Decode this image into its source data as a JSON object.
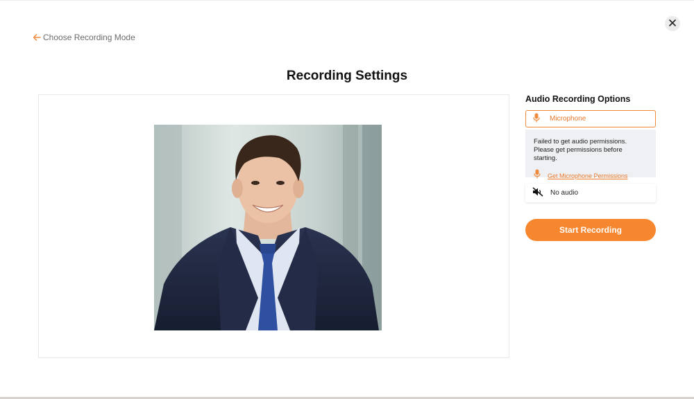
{
  "nav": {
    "back_label": "Choose Recording Mode",
    "back_icon": "arrow-left-icon",
    "close_icon": "close-icon"
  },
  "page": {
    "title": "Recording Settings"
  },
  "preview": {
    "description_icon": "camera-feed"
  },
  "audio": {
    "heading": "Audio Recording Options",
    "microphone_label": "Microphone",
    "permission_message": "Failed to get audio permissions. Please get permissions before starting.",
    "permission_link": "Get Microphone Permissions",
    "no_audio_label": "No audio",
    "start_label": "Start Recording"
  },
  "colors": {
    "accent": "#f7872f",
    "accent_text": "#e8792c",
    "panel_bg": "#eef0f3"
  }
}
